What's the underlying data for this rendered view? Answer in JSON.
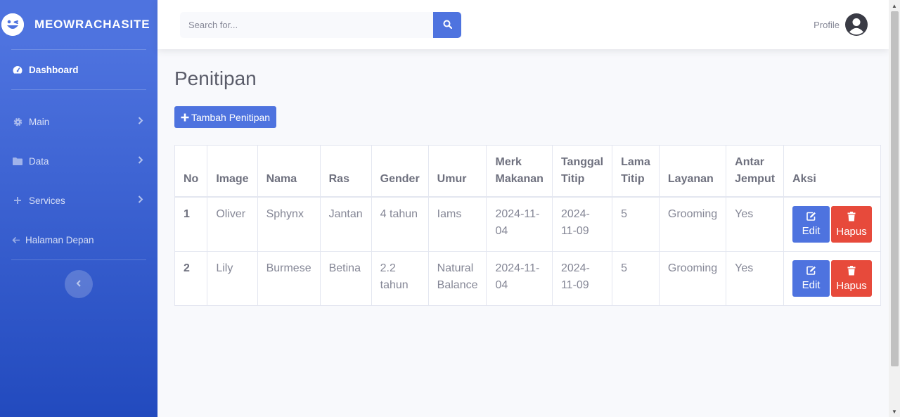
{
  "brand": {
    "name": "MEOWRACHASITE"
  },
  "sidebar": {
    "items": [
      {
        "label": "Dashboard",
        "icon": "tachometer-icon"
      },
      {
        "label": "Main",
        "icon": "cog-icon"
      },
      {
        "label": "Data",
        "icon": "folder-icon"
      },
      {
        "label": "Services",
        "icon": "plus-icon"
      },
      {
        "label": "Halaman Depan",
        "icon": "arrow-left-icon"
      }
    ]
  },
  "search": {
    "placeholder": "Search for..."
  },
  "profile": {
    "label": "Profile"
  },
  "page": {
    "title": "Penitipan",
    "add_button": "Tambah Penitipan"
  },
  "table": {
    "headers": [
      "No",
      "Image",
      "Nama",
      "Ras",
      "Gender",
      "Umur",
      "Merk Makanan",
      "Tanggal Titip",
      "Lama Titip",
      "Layanan",
      "Antar Jemput",
      "Aksi"
    ],
    "rows": [
      {
        "no": "1",
        "image": "Oliver",
        "nama": "Sphynx",
        "ras": "Jantan",
        "gender": "4 tahun",
        "umur": "Iams",
        "merk": "2024-11-04",
        "tanggal": "2024-11-09",
        "lama": "5",
        "layanan": "Grooming",
        "antar": "Yes"
      },
      {
        "no": "2",
        "image": "Lily",
        "nama": "Burmese",
        "ras": "Betina",
        "gender": "2.2 tahun",
        "umur": "Natural Balance",
        "merk": "2024-11-04",
        "tanggal": "2024-11-09",
        "lama": "5",
        "layanan": "Grooming",
        "antar": "Yes"
      }
    ],
    "edit_label": "Edit",
    "delete_label": "Hapus"
  },
  "colors": {
    "primary": "#4e73df",
    "danger": "#e74a3b",
    "background": "#f8f9fc"
  }
}
